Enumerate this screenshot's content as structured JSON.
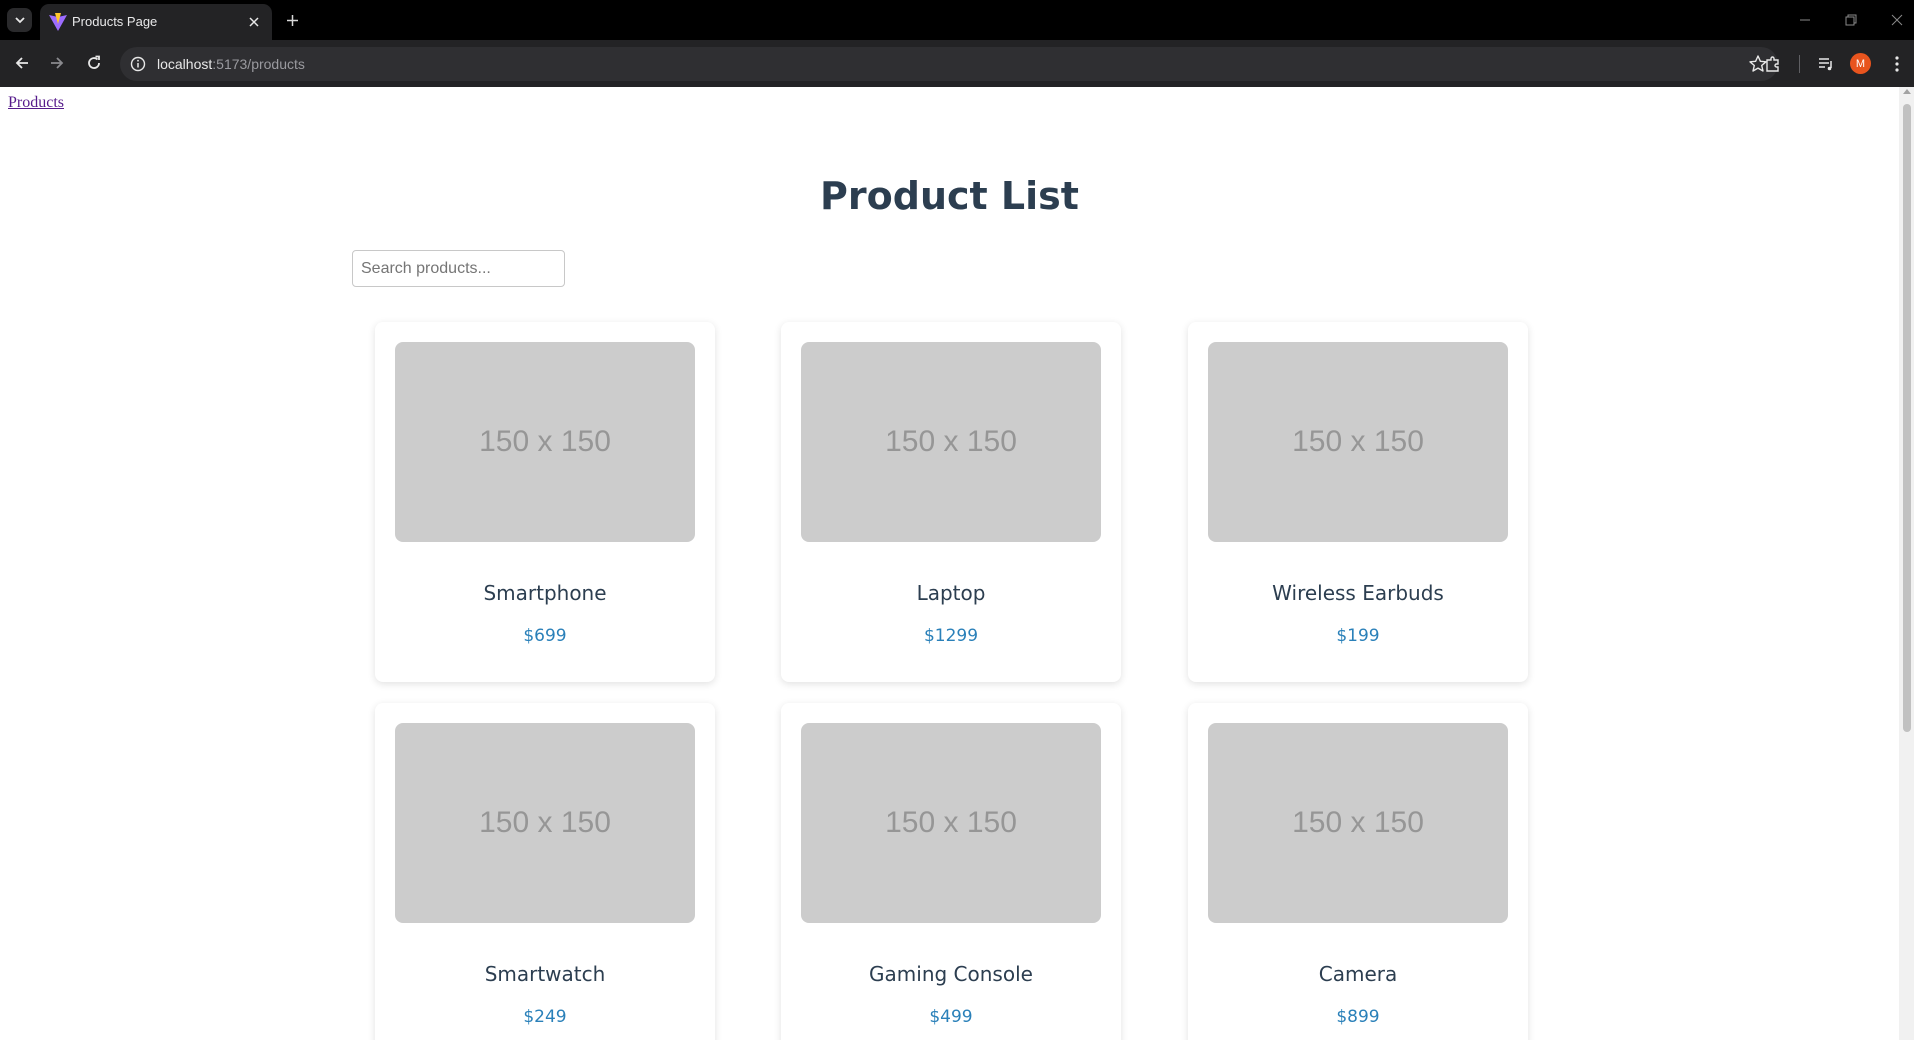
{
  "browser": {
    "tab_title": "Products Page",
    "url_host": "localhost",
    "url_path": ":5173/products",
    "profile_initial": "M"
  },
  "page": {
    "nav_link": "Products",
    "title": "Product List",
    "search": {
      "placeholder": "Search products...",
      "value": ""
    },
    "products": [
      {
        "image_text": "150 x 150",
        "name": "Smartphone",
        "price": "$699"
      },
      {
        "image_text": "150 x 150",
        "name": "Laptop",
        "price": "$1299"
      },
      {
        "image_text": "150 x 150",
        "name": "Wireless Earbuds",
        "price": "$199"
      },
      {
        "image_text": "150 x 150",
        "name": "Smartwatch",
        "price": "$249"
      },
      {
        "image_text": "150 x 150",
        "name": "Gaming Console",
        "price": "$499"
      },
      {
        "image_text": "150 x 150",
        "name": "Camera",
        "price": "$899"
      }
    ]
  },
  "colors": {
    "heading": "#2c3e50",
    "price": "#2a80b9",
    "placeholder_bg": "#cccccc",
    "visited_link": "#551a8b",
    "profile": "#e8541e"
  }
}
